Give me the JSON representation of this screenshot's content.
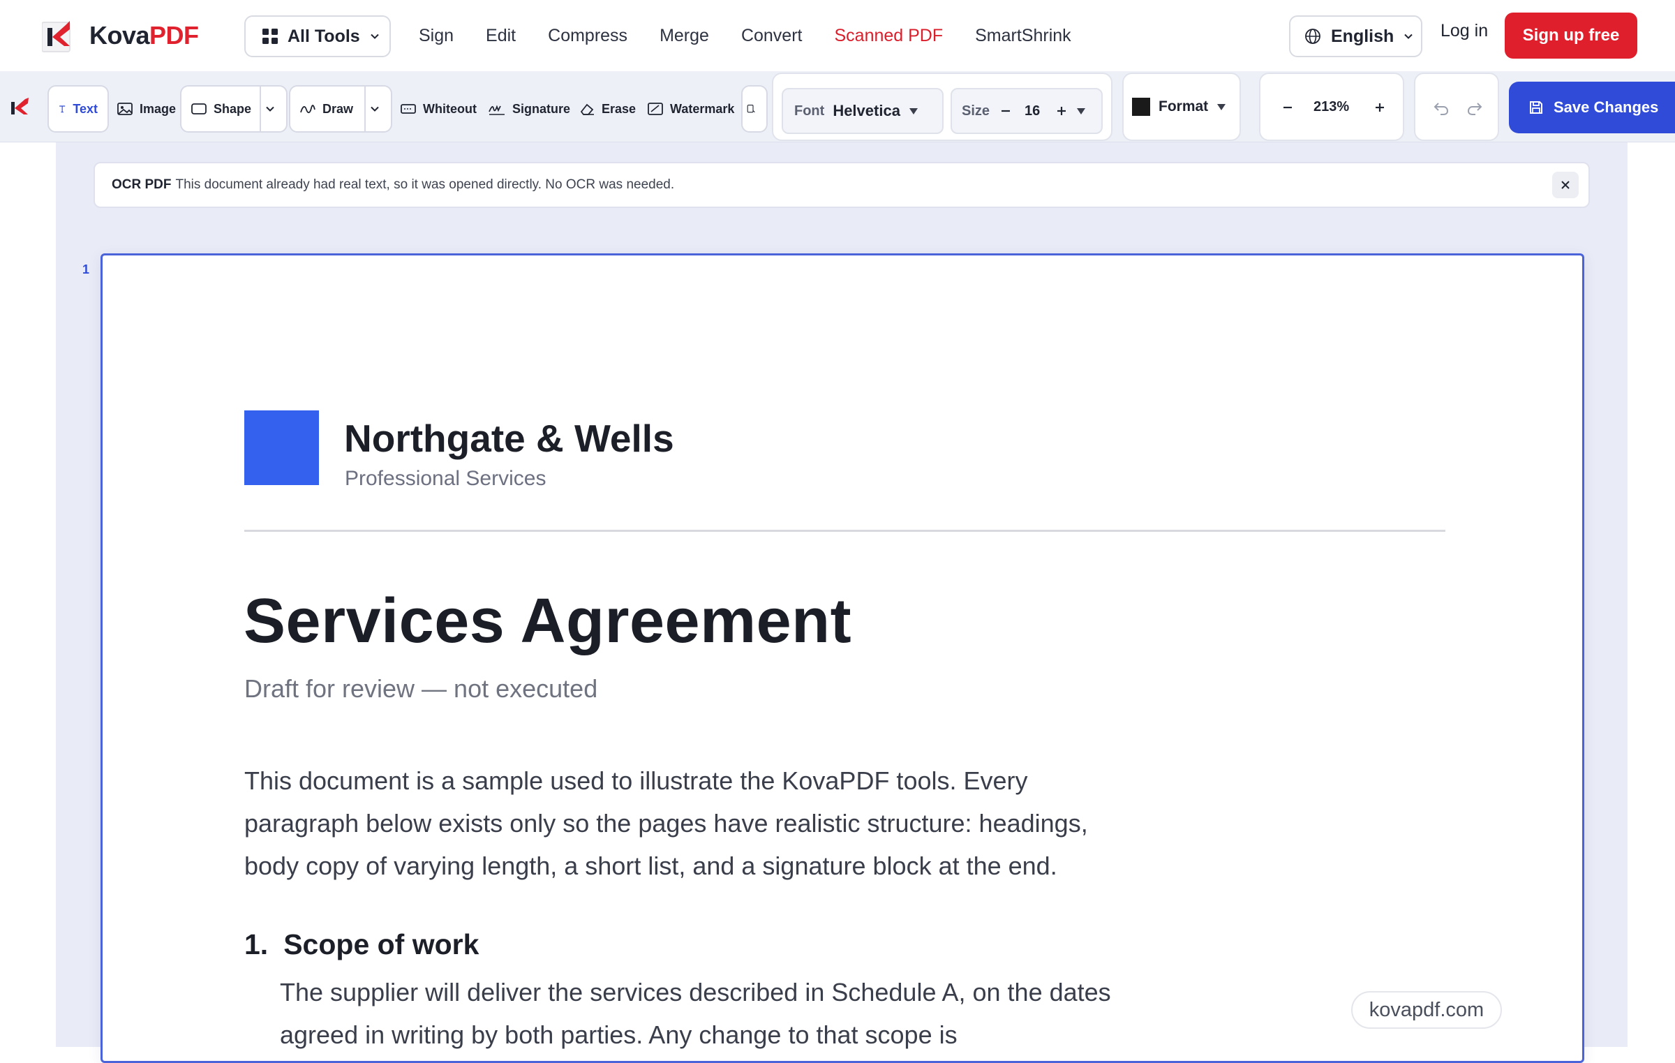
{
  "brand": {
    "name_part1": "Kova",
    "name_part2": "PDF"
  },
  "nav": {
    "all_tools": "All Tools",
    "links": [
      "Sign",
      "Edit",
      "Compress",
      "Merge",
      "Convert",
      "Scanned PDF",
      "SmartShrink"
    ],
    "active_link": "Scanned PDF",
    "language": "English",
    "login": "Log in",
    "signup": "Sign up free"
  },
  "toolbar": {
    "tools": {
      "text": "Text",
      "image": "Image",
      "shape": "Shape",
      "draw": "Draw",
      "whiteout": "Whiteout",
      "signature": "Signature",
      "erase": "Erase",
      "watermark": "Watermark"
    },
    "font_label": "Font",
    "font_value": "Helvetica",
    "size_label": "Size",
    "size_value": "16",
    "format_label": "Format",
    "format_color": "#1a1a1a",
    "zoom": "213%",
    "save": "Save Changes"
  },
  "ocr_notice": {
    "title": "OCR PDF",
    "message": "This document already had real text, so it was opened directly. No OCR was needed."
  },
  "page_number": "1",
  "document": {
    "company": "Northgate & Wells",
    "tagline": "Professional Services",
    "title": "Services Agreement",
    "subtitle": "Draft for review — not executed",
    "intro": "This document is a sample used to illustrate the KovaPDF tools. Every paragraph below exists only so the pages have realistic structure: headings, body copy of varying length, a short list, and a signature block at the end.",
    "section1_num": "1.",
    "section1_title": "Scope of work",
    "section1_body": "The supplier will deliver the services described in Schedule A, on the dates agreed in writing by both parties. Any change to that scope is"
  },
  "watermark_text": "kovapdf.com",
  "colors": {
    "brand_red": "#e01f2d",
    "accent_blue": "#2f4bd8",
    "logo_square": "#3561ef"
  }
}
